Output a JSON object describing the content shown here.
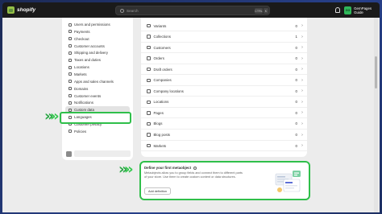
{
  "topbar": {
    "brand": "shopify",
    "search_placeholder": "Search",
    "shortcut_ctrl": "CTRL",
    "shortcut_k": "K",
    "store_initials": "GG",
    "store_name": "GemPages Guide"
  },
  "sidebar": {
    "items": [
      {
        "label": "Users and permissions",
        "icon": "users-icon"
      },
      {
        "label": "Payments",
        "icon": "payments-icon"
      },
      {
        "label": "Checkout",
        "icon": "checkout-icon"
      },
      {
        "label": "Customer accounts",
        "icon": "customer-accounts-icon"
      },
      {
        "label": "Shipping and delivery",
        "icon": "shipping-icon"
      },
      {
        "label": "Taxes and duties",
        "icon": "taxes-icon"
      },
      {
        "label": "Locations",
        "icon": "location-icon"
      },
      {
        "label": "Markets",
        "icon": "markets-icon"
      },
      {
        "label": "Apps and sales channels",
        "icon": "apps-icon"
      },
      {
        "label": "Domains",
        "icon": "domains-icon"
      },
      {
        "label": "Customer events",
        "icon": "customer-events-icon"
      },
      {
        "label": "Notifications",
        "icon": "notifications-icon"
      },
      {
        "label": "Custom data",
        "icon": "custom-data-icon"
      },
      {
        "label": "Languages",
        "icon": "languages-icon"
      },
      {
        "label": "Customer privacy",
        "icon": "privacy-icon"
      },
      {
        "label": "Policies",
        "icon": "policies-icon"
      }
    ],
    "active_item": "Custom data"
  },
  "metafields": {
    "rows": [
      {
        "label": "Variants",
        "count": "0"
      },
      {
        "label": "Collections",
        "count": "1"
      },
      {
        "label": "Customers",
        "count": "0"
      },
      {
        "label": "Orders",
        "count": "0"
      },
      {
        "label": "Draft orders",
        "count": "0"
      },
      {
        "label": "Companies",
        "count": "0"
      },
      {
        "label": "Company locations",
        "count": "0"
      },
      {
        "label": "Locations",
        "count": "0"
      },
      {
        "label": "Pages",
        "count": "0"
      },
      {
        "label": "Blogs",
        "count": "0"
      },
      {
        "label": "Blog posts",
        "count": "0"
      },
      {
        "label": "Markets",
        "count": "0"
      }
    ],
    "arrow": "›"
  },
  "metaobject": {
    "title": "Define your first metaobject",
    "description": "Metaobjects allow you to group fields and connect them to different parts of your store. Use them to create custom content or data structures.",
    "button_label": "Add definition"
  },
  "colors": {
    "highlight": "#2fbf4a",
    "topbar": "#1a1a1a",
    "store_avatar": "#2fb85a"
  }
}
